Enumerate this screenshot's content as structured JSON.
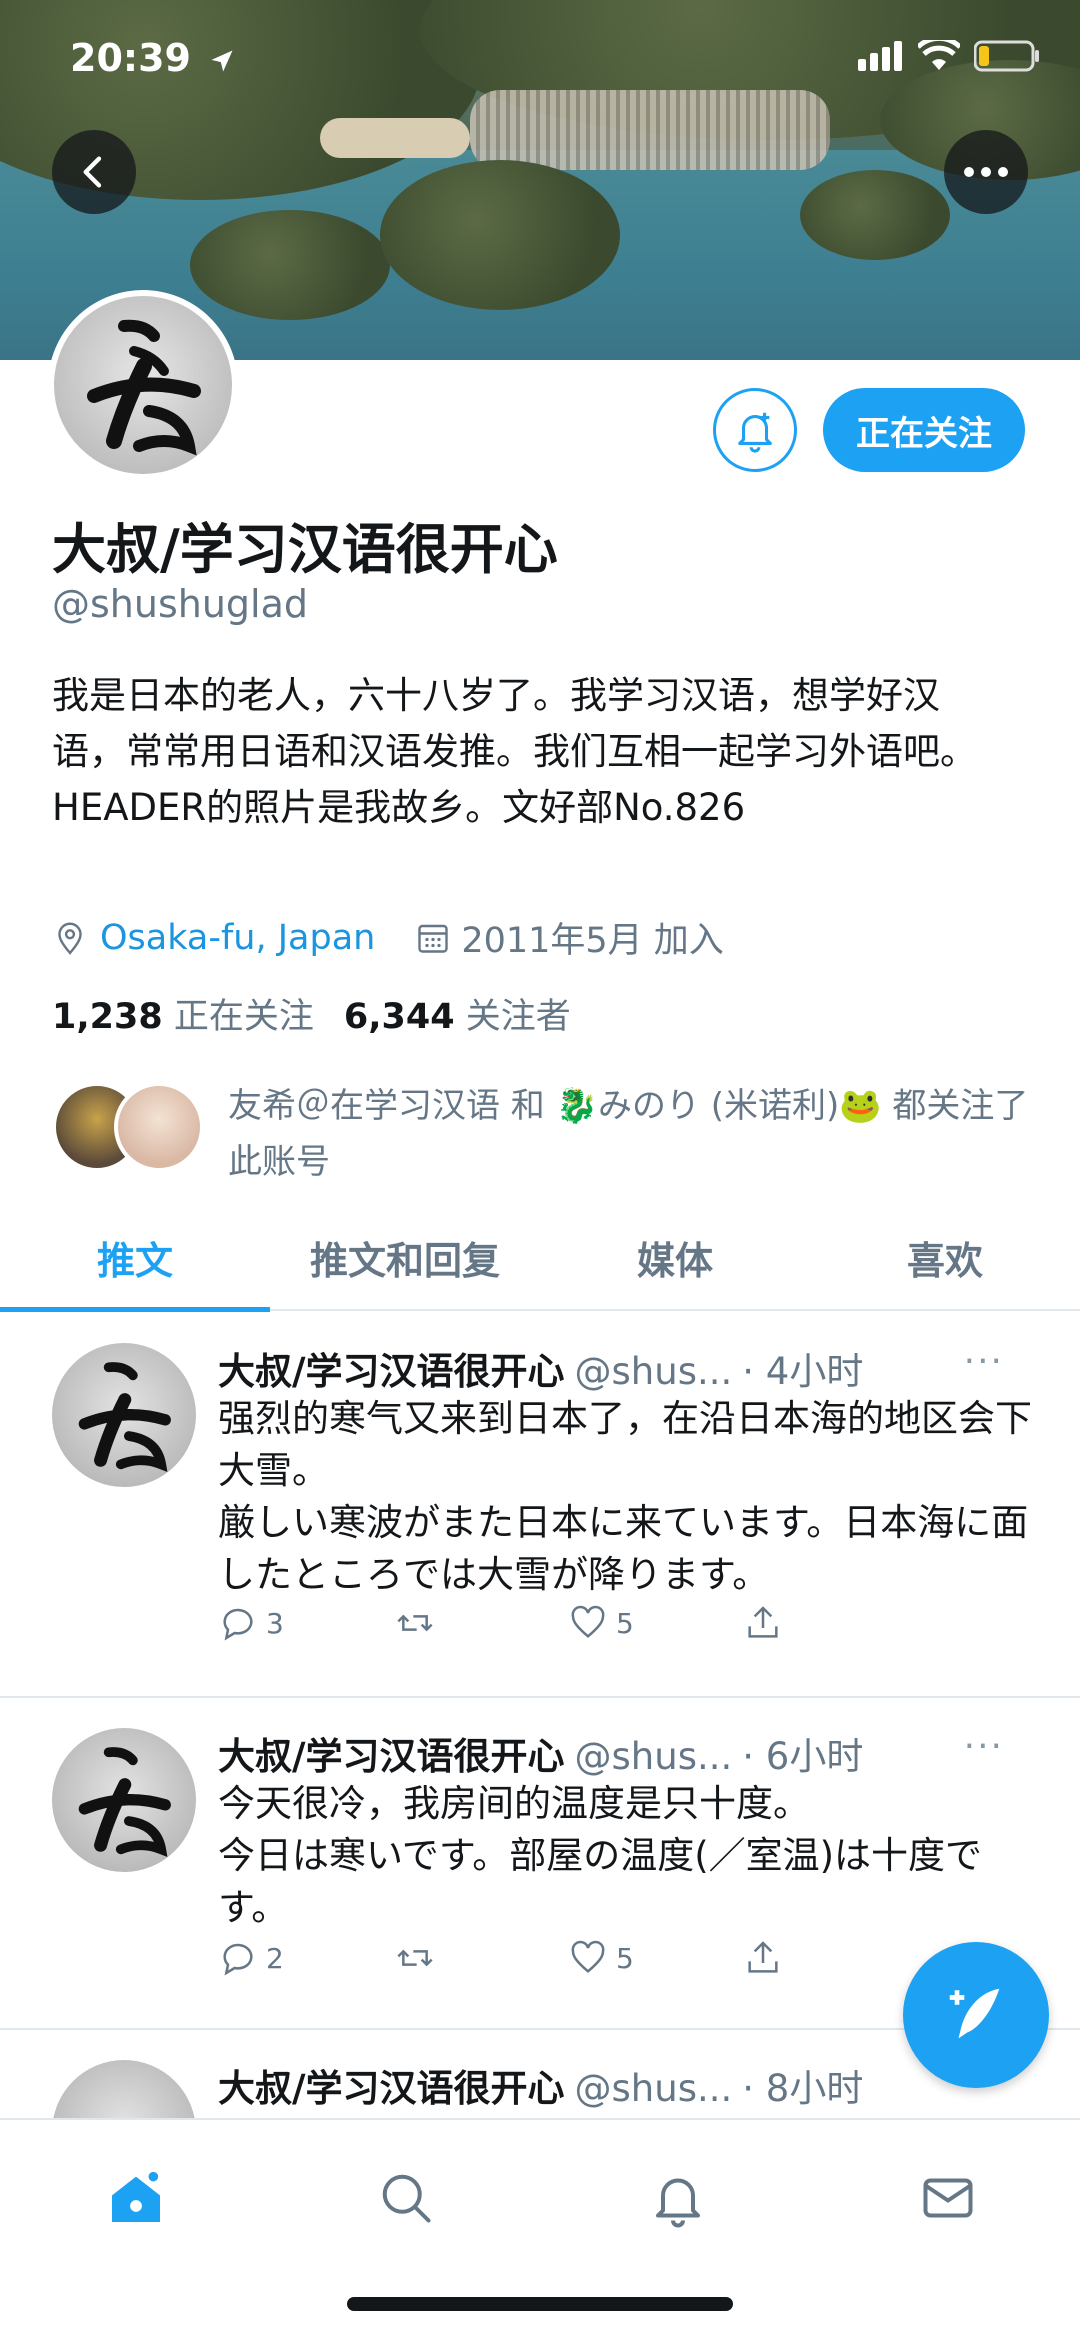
{
  "status_bar": {
    "time": "20:39"
  },
  "profile": {
    "display_name": "大叔/学习汉语很开心",
    "handle": "@shushuglad",
    "bio": "我是日本的老人，六十八岁了。我学习汉语，想学好汉语，常常用日语和汉语发推。我们互相一起学习外语吧。HEADER的照片是我故乡。文好部No.826",
    "location": "Osaka-fu, Japan",
    "joined": "2011年5月 加入",
    "following_count": "1,238",
    "following_label": "正在关注",
    "followers_count": "6,344",
    "followers_label": "关注者",
    "follow_button": "正在关注",
    "followed_by_text": "友希＠在学习汉语 和 🐉みのり (米诺利)🐸 都关注了此账号"
  },
  "tabs": [
    {
      "label": "推文"
    },
    {
      "label": "推文和回复"
    },
    {
      "label": "媒体"
    },
    {
      "label": "喜欢"
    }
  ],
  "tweets": [
    {
      "name": "大叔/学习汉语很开心",
      "handle": "@shus...",
      "time": "· 4小时",
      "text": "强烈的寒气又来到日本了，在沿日本海的地区会下大雪。\n厳しい寒波がまた日本に来ています。日本海に面したところでは大雪が降ります。",
      "replies": "3",
      "retweets": "",
      "likes": "5"
    },
    {
      "name": "大叔/学习汉语很开心",
      "handle": "@shus...",
      "time": "· 6小时",
      "text": "今天很冷，我房间的温度是只十度。\n今日は寒いです。部屋の温度(／室温)は十度です。",
      "replies": "2",
      "retweets": "",
      "likes": "5"
    },
    {
      "name": "大叔/学习汉语很开心",
      "handle": "@shus...",
      "time": "· 8小时",
      "text": "",
      "replies": "",
      "retweets": "",
      "likes": ""
    }
  ],
  "more_glyph": "···",
  "colors": {
    "accent": "#1da1f2",
    "secondary_text": "#657786",
    "border": "#e1e8ed"
  },
  "icons": [
    "back-arrow-icon",
    "more-icon",
    "bell-add-icon",
    "location-icon",
    "calendar-icon",
    "reply-icon",
    "retweet-icon",
    "like-icon",
    "share-icon",
    "compose-icon",
    "home-icon",
    "search-icon",
    "notifications-icon",
    "messages-icon"
  ]
}
